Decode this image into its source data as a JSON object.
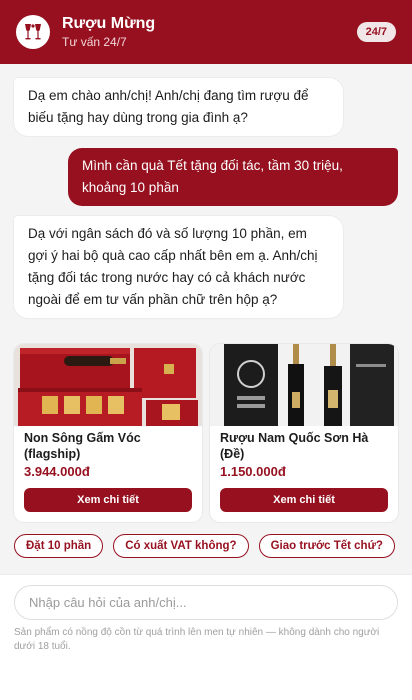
{
  "header": {
    "title": "Rượu Mừng",
    "subtitle": "Tư vấn 24/7",
    "badge": "24/7",
    "logo_icon": "wine-glasses-logo-icon"
  },
  "messages": [
    {
      "role": "bot",
      "text": "Dạ em chào anh/chị! Anh/chị đang tìm rượu để biếu tặng hay dùng trong gia đình ạ?"
    },
    {
      "role": "user",
      "text": "Mình cần quà Tết tặng đối tác, tầm 30 triệu, khoảng 10 phần"
    },
    {
      "role": "bot",
      "text": "Dạ với ngân sách đó và số lượng 10 phần, em gợi ý hai bộ quà cao cấp nhất bên em ạ. Anh/chị tặng đối tác trong nước hay có cả khách nước ngoài để em tư vấn phần chữ trên hộp ạ?"
    }
  ],
  "products": [
    {
      "name": "Non Sông Gấm Vóc (flagship)",
      "price": "3.944.000đ",
      "button": "Xem chi tiết",
      "image": "red-lacquer-gift-box-image"
    },
    {
      "name": "Rượu Nam Quốc Sơn Hà (Đề)",
      "price": "1.150.000đ",
      "button": "Xem chi tiết",
      "image": "dark-wine-bottles-image"
    }
  ],
  "quick_replies": [
    "Đặt 10 phần",
    "Có xuất VAT không?",
    "Giao trước Tết chứ?"
  ],
  "composer": {
    "placeholder": "Nhập câu hỏi của anh/chị...",
    "disclaimer": "Sản phẩm có nồng độ cồn từ quá trình lên men tự nhiên — không dành cho người dưới 18 tuổi."
  },
  "colors": {
    "brand": "#96101f",
    "chat_bg": "#f4f4f5",
    "price": "#96101f"
  }
}
